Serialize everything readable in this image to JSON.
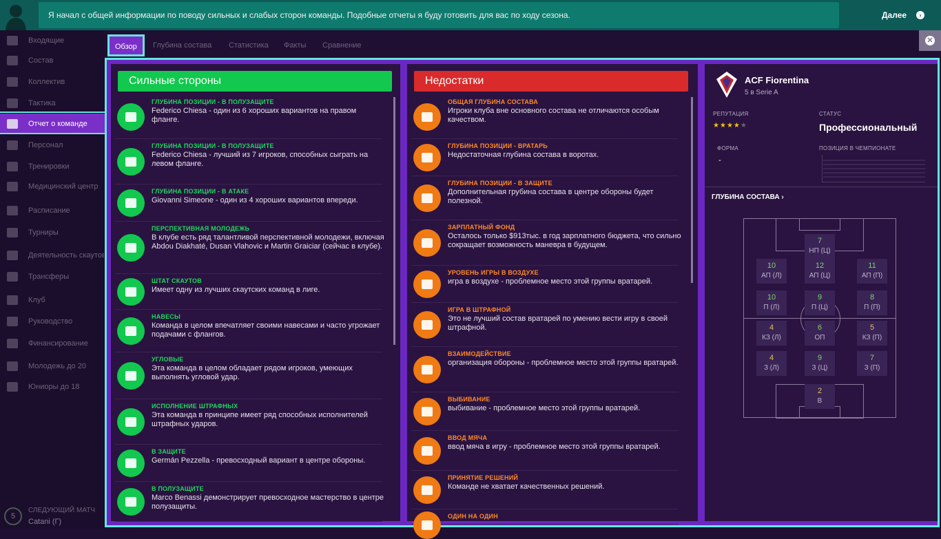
{
  "banner": {
    "message": "Я начал с общей информации по поводу сильных и слабых сторон команды. Подобные отчеты я буду готовить для вас по ходу сезона.",
    "next_label": "Далее"
  },
  "sidebar": {
    "items": [
      {
        "label": "Входящие"
      },
      {
        "label": "Состав"
      },
      {
        "label": "Коллектив"
      },
      {
        "label": "Тактика"
      },
      {
        "label": "Отчет о команде"
      },
      {
        "label": "Персонал"
      },
      {
        "label": "Тренировки"
      },
      {
        "label": "Медицинский центр"
      },
      {
        "label": "Расписание"
      },
      {
        "label": "Турниры"
      },
      {
        "label": "Деятельность скаутов"
      },
      {
        "label": "Трансферы"
      },
      {
        "label": "Клуб"
      },
      {
        "label": "Руководство"
      },
      {
        "label": "Финансирование"
      },
      {
        "label": "Молодежь до 20"
      },
      {
        "label": "Юниоры до 18"
      }
    ],
    "active_index": 4,
    "next_match": {
      "label": "СЛЕДУЮЩИЙ МАТЧ",
      "value": "Catani (Г)",
      "day": "5"
    }
  },
  "tabs": [
    "Обзор",
    "Глубина состава",
    "Статистика",
    "Факты",
    "Сравнение"
  ],
  "strengths": {
    "title": "Сильные стороны",
    "items": [
      {
        "title": "ГЛУБИНА ПОЗИЦИИ - В ПОЛУЗАЩИТЕ",
        "desc": "Federico Chiesa - один из 6 хороших вариантов на правом фланге.",
        "icon": "squad-depth-icon"
      },
      {
        "title": "ГЛУБИНА ПОЗИЦИИ - В ПОЛУЗАЩИТЕ",
        "desc": "Federico Chiesa - лучший из 7 игроков, способных сыграть на левом фланге.",
        "icon": "squad-depth-icon"
      },
      {
        "title": "ГЛУБИНА ПОЗИЦИИ - В АТАКЕ",
        "desc": "Giovanni Simeone - один из 4 хороших вариантов впереди.",
        "icon": "squad-depth-icon"
      },
      {
        "title": "ПЕРСПЕКТИВНАЯ МОЛОДЕЖЬ",
        "desc": "В клубе есть ряд талантливой перспективной молодежи, включая Abdou Diakhaté, Dusan Vlahovic и Martin Graiciar (сейчас в клубе).",
        "icon": "bottle-icon"
      },
      {
        "title": "ШТАТ СКАУТОВ",
        "desc": "Имеет одну из лучших скаутских команд в лиге.",
        "icon": "scouts-icon"
      },
      {
        "title": "НАВЕСЫ",
        "desc": "Команда в целом впечатляет своими навесами и часто угрожает подачами с флангов.",
        "icon": "cross-ball-icon"
      },
      {
        "title": "УГЛОВЫЕ",
        "desc": "Эта команда в целом обладает рядом игроков, умеющих выполнять угловой удар.",
        "icon": "corner-icon"
      },
      {
        "title": "ИСПОЛНЕНИЕ ШТРАФНЫХ",
        "desc": "Эта команда в принципе имеет ряд способных исполнителей штрафных ударов.",
        "icon": "free-kick-icon"
      },
      {
        "title": "В ЗАЩИТЕ",
        "desc": "Germán Pezzella - превосходный вариант в центре обороны.",
        "icon": "star-player-icon"
      },
      {
        "title": "В ПОЛУЗАЩИТЕ",
        "desc": "Marco Benassi демонстрирует превосходное мастерство в центре полузащиты.",
        "icon": "star-player-icon"
      }
    ]
  },
  "weaknesses": {
    "title": "Недостатки",
    "items": [
      {
        "title": "ОБЩАЯ ГЛУБИНА СОСТАВА",
        "desc": "Игроки клуба вне основного состава не отличаются особым качеством.",
        "icon": "squad-depth-icon"
      },
      {
        "title": "ГЛУБИНА ПОЗИЦИИ - ВРАТАРЬ",
        "desc": "Недостаточная глубина состава в воротах.",
        "icon": "squad-depth-icon"
      },
      {
        "title": "ГЛУБИНА ПОЗИЦИИ - В ЗАЩИТЕ",
        "desc": "Дополнительная грубина состава в центре обороны будет полезной.",
        "icon": "squad-depth-icon"
      },
      {
        "title": "ЗАРПЛАТНЫЙ ФОНД",
        "desc": "Осталось только $913тыс. в год зарплатного бюджета, что сильно сокращает возможность маневра в будущем.",
        "icon": "coins-icon"
      },
      {
        "title": "УРОВЕНЬ ИГРЫ В ВОЗДУХЕ",
        "desc": "игра в воздухе - проблемное место этой группы вратарей.",
        "icon": "goalkeeper-aerial-icon"
      },
      {
        "title": "ИГРА В ШТРАФНОЙ",
        "desc": "Это не лучший состав вратарей по умению вести игру в своей штрафной.",
        "icon": "penalty-area-icon"
      },
      {
        "title": "ВЗАИМОДЕЙСТВИЕ",
        "desc": "организация обороны - проблемное место этой группы вратарей.",
        "icon": "megaphone-icon"
      },
      {
        "title": "ВЫБИВАНИЕ",
        "desc": "выбивание - проблемное место этой группы вратарей.",
        "icon": "kicking-icon"
      },
      {
        "title": "ВВОД МЯЧА",
        "desc": "ввод мяча в игру - проблемное место этой группы вратарей.",
        "icon": "throwing-icon"
      },
      {
        "title": "ПРИНЯТИЕ РЕШЕНИЙ",
        "desc": "Команде не хватает качественных решений.",
        "icon": "signpost-icon"
      },
      {
        "title": "ОДИН НА ОДИН",
        "desc": "",
        "icon": "one-on-one-icon"
      }
    ]
  },
  "club": {
    "name": "ACF Fiorentina",
    "league_position": "5 в Serie A",
    "reputation_label": "РЕПУТАЦИЯ",
    "reputation_stars": 4,
    "reputation_max": 5,
    "status_label": "СТАТУС",
    "status_value": "Профессиональный",
    "form_label": "ФОРМА",
    "form_value": "-",
    "league_pos_label": "ПОЗИЦИЯ В ЧЕМПИОНАТЕ",
    "depth_link": "ГЛУБИНА СОСТАВА"
  },
  "depth_positions": [
    {
      "num": "7",
      "pos": "НП (Ц)",
      "color": "#7fd36a"
    },
    {
      "num": "10",
      "pos": "АП (Л)",
      "color": "#7fd36a"
    },
    {
      "num": "12",
      "pos": "АП (Ц)",
      "color": "#7fd36a"
    },
    {
      "num": "11",
      "pos": "АП (П)",
      "color": "#7fd36a"
    },
    {
      "num": "10",
      "pos": "П (Л)",
      "color": "#7fd36a"
    },
    {
      "num": "9",
      "pos": "П (Ц)",
      "color": "#7fd36a"
    },
    {
      "num": "8",
      "pos": "П (П)",
      "color": "#7fd36a"
    },
    {
      "num": "4",
      "pos": "КЗ (Л)",
      "color": "#e0c060"
    },
    {
      "num": "6",
      "pos": "ОП",
      "color": "#7fd36a"
    },
    {
      "num": "5",
      "pos": "КЗ (П)",
      "color": "#e0c060"
    },
    {
      "num": "4",
      "pos": "З (Л)",
      "color": "#e0c060"
    },
    {
      "num": "9",
      "pos": "З (Ц)",
      "color": "#7fd36a"
    },
    {
      "num": "7",
      "pos": "З (П)",
      "color": "#7fd36a"
    },
    {
      "num": "2",
      "pos": "В",
      "color": "#e0c060"
    }
  ],
  "colors": {
    "accent": "#66e6e0",
    "purple": "#7a2fc9",
    "green": "#12c84e",
    "red": "#d92b2b",
    "orange": "#f07a14"
  }
}
